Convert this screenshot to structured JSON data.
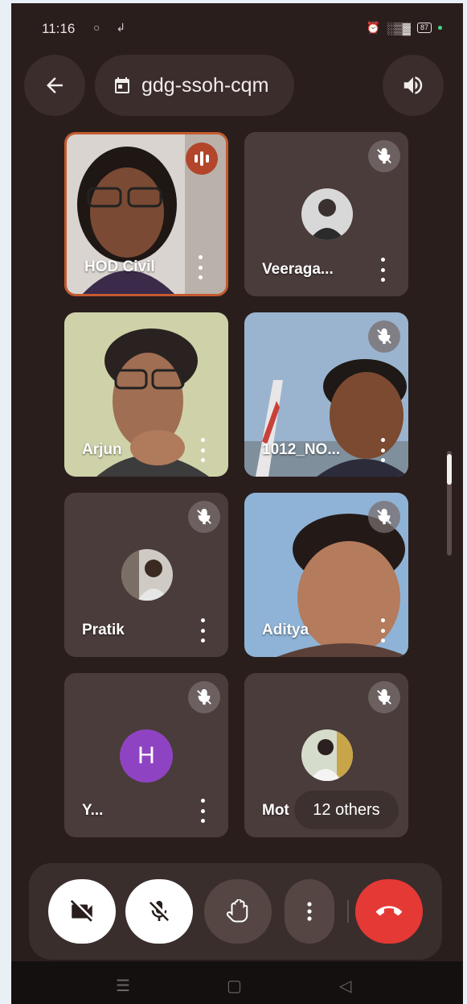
{
  "status_bar": {
    "time": "11:16",
    "left_icons": "❂ ⚗",
    "battery": "87"
  },
  "meeting": {
    "code": "gdg-ssoh-cqm"
  },
  "participants": [
    {
      "name": "HOD Civil",
      "state": "speaking"
    },
    {
      "name": "Veeraga...",
      "state": "muted"
    },
    {
      "name": "Arjun",
      "state": "unmuted"
    },
    {
      "name": "1012_NO...",
      "state": "muted"
    },
    {
      "name": "Pratik",
      "state": "muted"
    },
    {
      "name": "Aditya",
      "state": "muted"
    },
    {
      "name": "Y...",
      "state": "muted",
      "avatar_letter": "H"
    },
    {
      "name": "Mot",
      "state": "muted"
    }
  ],
  "others_label": "12 others",
  "colors": {
    "background": "#2a1e1d",
    "tile": "#4a3c3a",
    "speaking_accent": "#c45a2f",
    "end_call": "#e53935",
    "avatar_letter_bg": "#8e44c2"
  },
  "controls": {
    "camera": "camera-off-icon",
    "mic": "mic-off-icon",
    "raise_hand": "hand-icon",
    "more": "more-vert-icon",
    "end_call": "end-call-icon"
  }
}
